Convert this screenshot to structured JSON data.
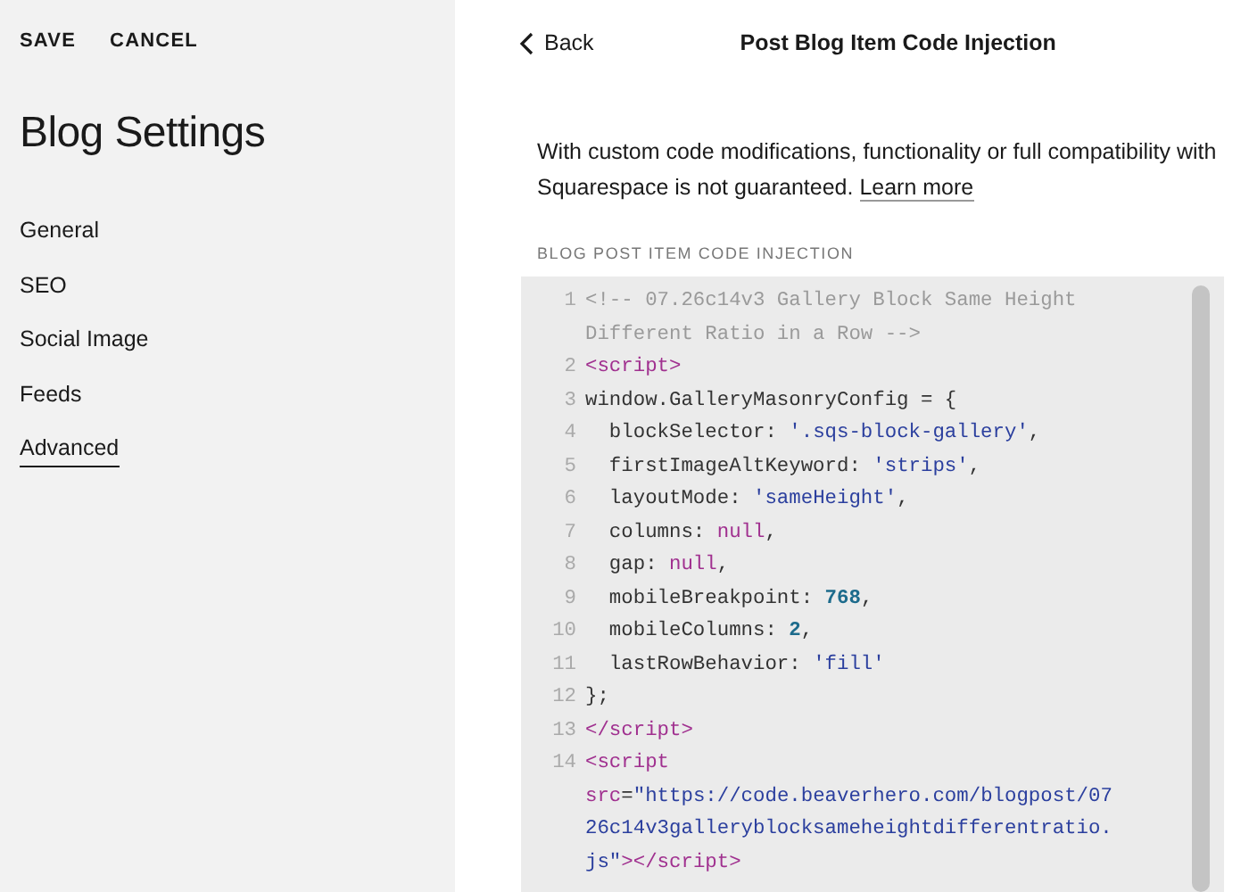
{
  "sidebar": {
    "actions": [
      "SAVE",
      "CANCEL"
    ],
    "title": "Blog Settings",
    "items": [
      {
        "label": "General",
        "selected": false
      },
      {
        "label": "SEO",
        "selected": false
      },
      {
        "label": "Social Image",
        "selected": false
      },
      {
        "label": "Feeds",
        "selected": false
      },
      {
        "label": "Advanced",
        "selected": true
      }
    ]
  },
  "header": {
    "back": "Back",
    "title": "Post Blog Item Code Injection"
  },
  "notice": {
    "text": "With custom code modifications, functionality or full compatibility with Squarespace is not guaranteed.",
    "link": "Learn more"
  },
  "section_label": "BLOG POST ITEM CODE INJECTION",
  "code": [
    {
      "number": "1",
      "rows": [
        [
          {
            "kind": "comment",
            "text": "<!-- 07.26c14v3 Gallery Block Same Height"
          }
        ],
        [
          {
            "kind": "comment",
            "text": "Different Ratio in a Row -->"
          }
        ]
      ]
    },
    {
      "number": "2",
      "rows": [
        [
          {
            "kind": "tag",
            "text": "<script>"
          }
        ]
      ]
    },
    {
      "number": "3",
      "rows": [
        [
          {
            "kind": "plain",
            "text": "window.GalleryMasonryConfig = {"
          }
        ]
      ]
    },
    {
      "number": "4",
      "rows": [
        [
          {
            "kind": "plain",
            "text": "  blockSelector: "
          },
          {
            "kind": "string",
            "text": "'.sqs-block-gallery'"
          },
          {
            "kind": "plain",
            "text": ","
          }
        ]
      ]
    },
    {
      "number": "5",
      "rows": [
        [
          {
            "kind": "plain",
            "text": "  firstImageAltKeyword: "
          },
          {
            "kind": "string",
            "text": "'strips'"
          },
          {
            "kind": "plain",
            "text": ","
          }
        ]
      ]
    },
    {
      "number": "6",
      "rows": [
        [
          {
            "kind": "plain",
            "text": "  layoutMode: "
          },
          {
            "kind": "string",
            "text": "'sameHeight'"
          },
          {
            "kind": "plain",
            "text": ","
          }
        ]
      ]
    },
    {
      "number": "7",
      "rows": [
        [
          {
            "kind": "plain",
            "text": "  columns: "
          },
          {
            "kind": "keyword",
            "text": "null"
          },
          {
            "kind": "plain",
            "text": ","
          }
        ]
      ]
    },
    {
      "number": "8",
      "rows": [
        [
          {
            "kind": "plain",
            "text": "  gap: "
          },
          {
            "kind": "keyword",
            "text": "null"
          },
          {
            "kind": "plain",
            "text": ","
          }
        ]
      ]
    },
    {
      "number": "9",
      "rows": [
        [
          {
            "kind": "plain",
            "text": "  mobileBreakpoint: "
          },
          {
            "kind": "number",
            "text": "768"
          },
          {
            "kind": "plain",
            "text": ","
          }
        ]
      ]
    },
    {
      "number": "10",
      "rows": [
        [
          {
            "kind": "plain",
            "text": "  mobileColumns: "
          },
          {
            "kind": "number",
            "text": "2"
          },
          {
            "kind": "plain",
            "text": ","
          }
        ]
      ]
    },
    {
      "number": "11",
      "rows": [
        [
          {
            "kind": "plain",
            "text": "  lastRowBehavior: "
          },
          {
            "kind": "string",
            "text": "'fill'"
          }
        ]
      ]
    },
    {
      "number": "12",
      "rows": [
        [
          {
            "kind": "plain",
            "text": "};"
          }
        ]
      ]
    },
    {
      "number": "13",
      "rows": [
        [
          {
            "kind": "tag",
            "text": "</script>"
          }
        ]
      ]
    },
    {
      "number": "14",
      "rows": [
        [
          {
            "kind": "tag",
            "text": "<script"
          }
        ],
        [
          {
            "kind": "attr",
            "text": "src"
          },
          {
            "kind": "plain",
            "text": "="
          },
          {
            "kind": "string",
            "text": "\"https://code.beaverhero.com/blogpost/07"
          }
        ],
        [
          {
            "kind": "string",
            "text": "26c14v3galleryblocksameheightdifferentratio."
          }
        ],
        [
          {
            "kind": "string",
            "text": "js\""
          },
          {
            "kind": "tag",
            "text": "></script>"
          }
        ]
      ]
    }
  ]
}
